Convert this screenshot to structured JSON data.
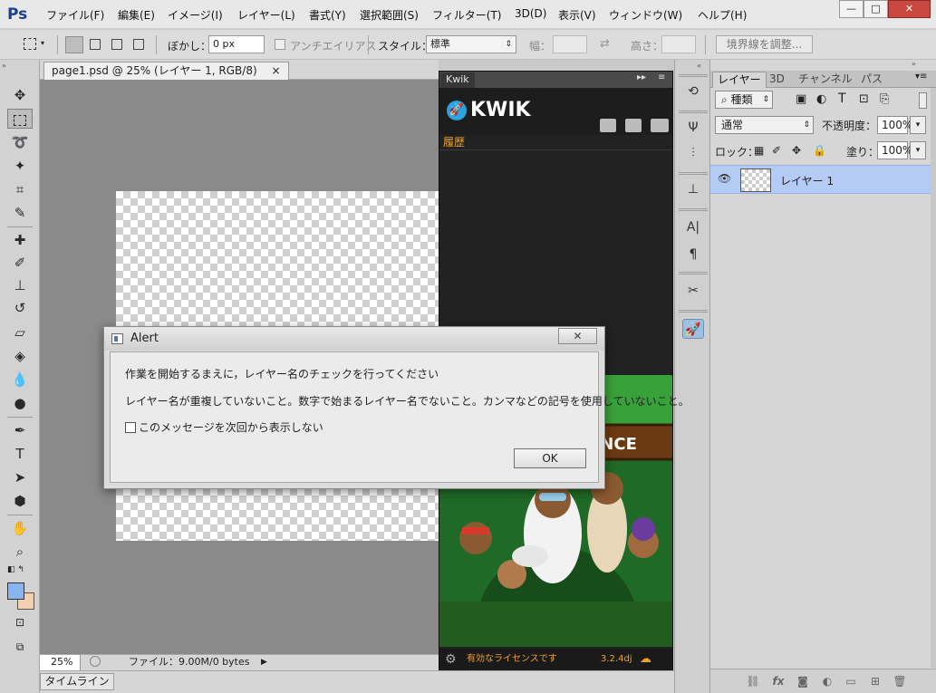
{
  "app": {
    "logo": "Ps"
  },
  "menu": [
    "ファイル(F)",
    "編集(E)",
    "イメージ(I)",
    "レイヤー(L)",
    "書式(Y)",
    "選択範囲(S)",
    "フィルター(T)",
    "3D(D)",
    "表示(V)",
    "ウィンドウ(W)",
    "ヘルプ(H)"
  ],
  "window_controls": {
    "minimize": "—",
    "maximize": "□",
    "close": "✕"
  },
  "options": {
    "feather_label": "ぼかし：",
    "feather_value": "0 px",
    "antialias_label": "アンチエイリアス",
    "style_label": "スタイル：",
    "style_value": "標準",
    "width_label": "幅：",
    "height_label": "高さ：",
    "refine_edge": "境界線を調整..."
  },
  "document": {
    "tab_title": "page1.psd @ 25% (レイヤー 1, RGB/8)",
    "close": "×",
    "zoom": "25%",
    "file_info": "ファイル：9.00M/0 bytes",
    "timeline": "タイムライン"
  },
  "kwik": {
    "tab": "Kwik",
    "brand": "KWIK",
    "nav": "履歴",
    "footer_status": "有効なライセンスです",
    "version": "3.2.4dj",
    "banner_text": "ENCE"
  },
  "layers_panel": {
    "tabs": [
      "レイヤー",
      "3D",
      "チャンネル",
      "パス"
    ],
    "filter_kind": "種類",
    "blend_mode": "通常",
    "opacity_label": "不透明度：",
    "opacity_value": "100%",
    "lock_label": "ロック：",
    "fill_label": "塗り：",
    "fill_value": "100%",
    "layer_name": "レイヤー 1"
  },
  "alert": {
    "title": "Alert",
    "close": "✕",
    "message1": "作業を開始するまえに，レイヤー名のチェックを行ってください",
    "message2": "レイヤー名が重複していないこと。数字で始まるレイヤー名でないこと。カンマなどの記号を使用していないこと。",
    "checkbox_label": "このメッセージを次回から表示しない",
    "ok": "OK"
  },
  "colors": {
    "accent_orange": "#f0a21f",
    "kwik_blue": "#2aa3e0",
    "selection_blue": "#b4cbf5"
  }
}
